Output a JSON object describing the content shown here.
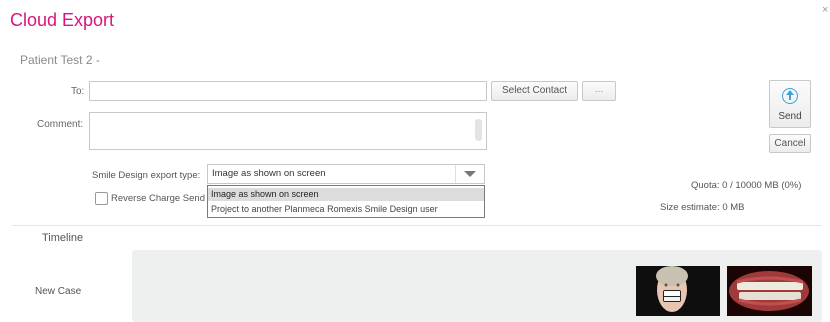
{
  "dialog": {
    "title": "Cloud Export",
    "close_glyph": "×"
  },
  "patient": {
    "name": "Patient Test 2 -"
  },
  "form": {
    "to_label": "To:",
    "to_value": "",
    "select_contact_label": "Select Contact",
    "more_label": "...",
    "comment_label": "Comment:",
    "comment_value": "",
    "export_type_label": "Smile Design export type:",
    "export_type_selected": "Image as shown on screen",
    "export_type_options": [
      "Image as shown on screen",
      "Project to another Planmeca Romexis Smile Design user"
    ],
    "reverse_charge_label": "Reverse Charge Send",
    "reverse_charge_checked": false
  },
  "actions": {
    "send_label": "Send",
    "cancel_label": "Cancel"
  },
  "info": {
    "quota_label": "Quota:",
    "quota_value": "0 / 10000 MB (0%)",
    "size_label": "Size estimate:",
    "size_value": "0 MB"
  },
  "timeline": {
    "heading": "Timeline",
    "case_label": "New Case"
  },
  "colors": {
    "title": "#d6157e",
    "accent": "#3da0d8",
    "panel": "#eef0f0"
  },
  "icons": [
    "cloud-upload-icon",
    "chevron-down-icon",
    "close-icon"
  ]
}
